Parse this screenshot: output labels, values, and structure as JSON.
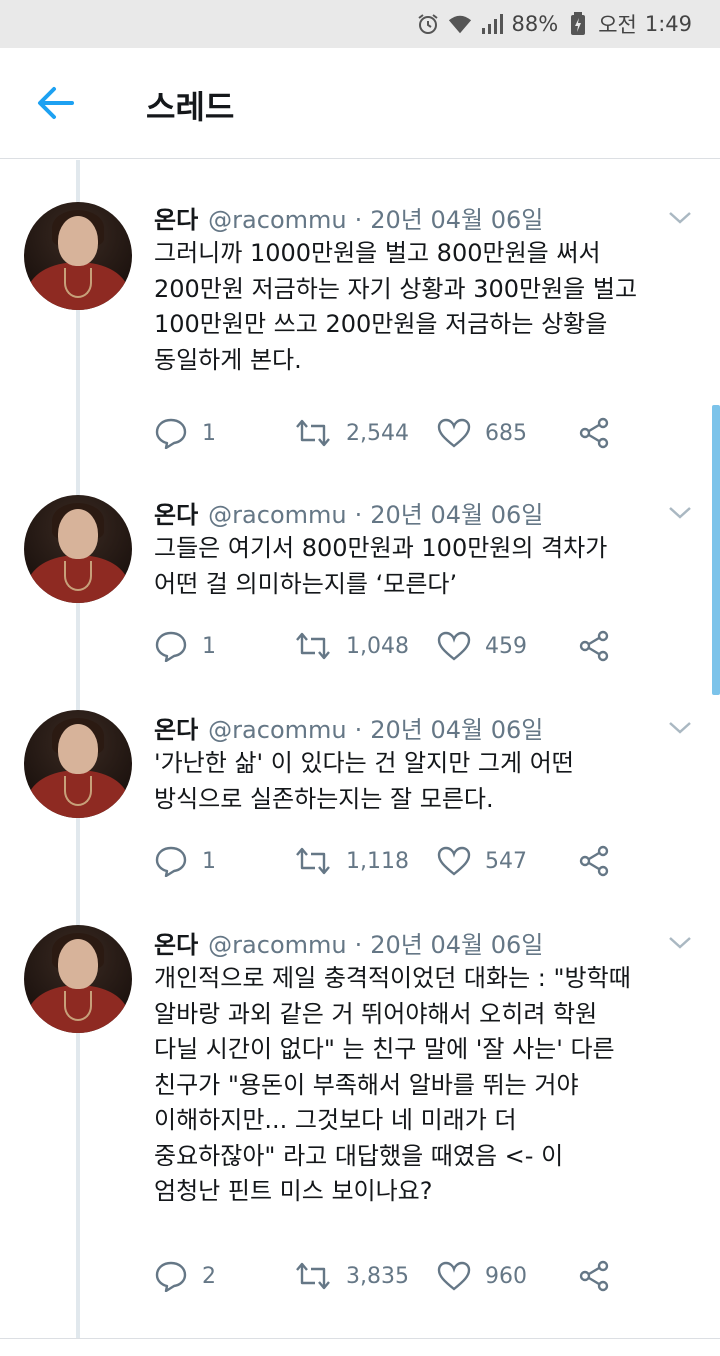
{
  "status_bar": {
    "battery": "88%",
    "ampm": "오전",
    "time": "1:49"
  },
  "header": {
    "title": "스레드"
  },
  "colors": {
    "accent": "#1da1f2",
    "muted": "#657786",
    "thread_line": "#e1e8ed",
    "scroll": "#7cc3ea"
  },
  "tweets": [
    {
      "name": "온다",
      "handle": "@racommu",
      "separator": "·",
      "date": "20년 04월 06일",
      "text": "그러니까 1000만원을 벌고 800만원을 써서\n200만원 저금하는 자기 상황과 300만원을 벌고\n100만원만 쓰고 200만원을 저금하는 상황을\n동일하게 본다.",
      "replies": "1",
      "retweets": "2,544",
      "likes": "685"
    },
    {
      "name": "온다",
      "handle": "@racommu",
      "separator": "·",
      "date": "20년 04월 06일",
      "text": "그들은 여기서 800만원과 100만원의 격차가\n어떤 걸 의미하는지를 ‘모른다’",
      "replies": "1",
      "retweets": "1,048",
      "likes": "459"
    },
    {
      "name": "온다",
      "handle": "@racommu",
      "separator": "·",
      "date": "20년 04월 06일",
      "text": "'가난한 삶' 이 있다는 건 알지만 그게 어떤\n방식으로 실존하는지는 잘 모른다.",
      "replies": "1",
      "retweets": "1,118",
      "likes": "547"
    },
    {
      "name": "온다",
      "handle": "@racommu",
      "separator": "·",
      "date": "20년 04월 06일",
      "text": "개인적으로 제일 충격적이었던 대화는 : \"방학때\n알바랑 과외 같은 거 뛰어야해서 오히려 학원\n다닐 시간이 없다\" 는 친구 말에 '잘 사는' 다른\n친구가 \"용돈이 부족해서 알바를 뛰는 거야\n이해하지만... 그것보다 네 미래가 더\n중요하잖아\" 라고 대답했을 때였음 <- 이\n엄청난 핀트 미스 보이나요?",
      "replies": "2",
      "retweets": "3,835",
      "likes": "960"
    }
  ]
}
